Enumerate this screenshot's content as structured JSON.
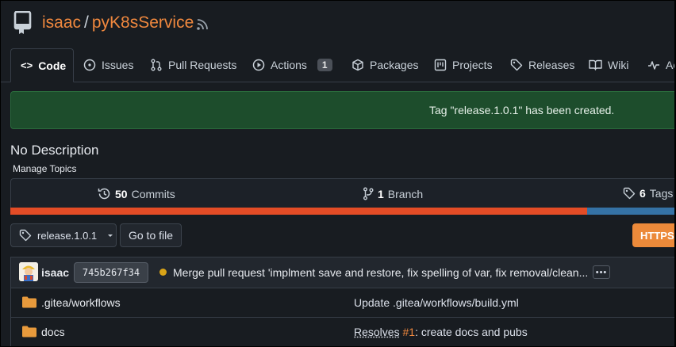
{
  "repo": {
    "owner": "isaac",
    "separator": "/",
    "name": "pyK8sService"
  },
  "tabs": [
    {
      "label": "Code"
    },
    {
      "label": "Issues"
    },
    {
      "label": "Pull Requests"
    },
    {
      "label": "Actions",
      "badge": "1"
    },
    {
      "label": "Packages"
    },
    {
      "label": "Projects"
    },
    {
      "label": "Releases"
    },
    {
      "label": "Wiki"
    },
    {
      "label": "Ac"
    }
  ],
  "flash": {
    "message": "Tag \"release.1.0.1\" has been created."
  },
  "description": "No Description",
  "manage_topics": "Manage Topics",
  "stats": {
    "commits_count": "50",
    "commits_label": "Commits",
    "branch_count": "1",
    "branch_label": "Branch",
    "tags_count": "6",
    "tags_label": "Tags"
  },
  "branch_selector": {
    "value": "release.1.0.1"
  },
  "goto_file": "Go to file",
  "clone": {
    "https": "HTTPS"
  },
  "latest_commit": {
    "author": "isaac",
    "sha": "745b267f34",
    "message": "Merge pull request 'implment save and restore, fix spelling of var, fix removal/clean..."
  },
  "files": [
    {
      "dir": ".gitea",
      "sub": "/workflows",
      "message": "Update .gitea/workflows/build.yml"
    },
    {
      "name": "docs",
      "msg_link": "Resolves",
      "msg_issue": "#1",
      "msg_rest": ": create docs and pubs"
    }
  ],
  "colors": {
    "accent": "#f0883e",
    "success_bg": "#1d4d2c",
    "lang_python": "#e34c26",
    "lang_other": "#3572a5"
  },
  "language_bar": [
    {
      "fraction": 0.855,
      "color": "#e34c26"
    },
    {
      "fraction": 0.145,
      "color": "#3572a5"
    }
  ]
}
